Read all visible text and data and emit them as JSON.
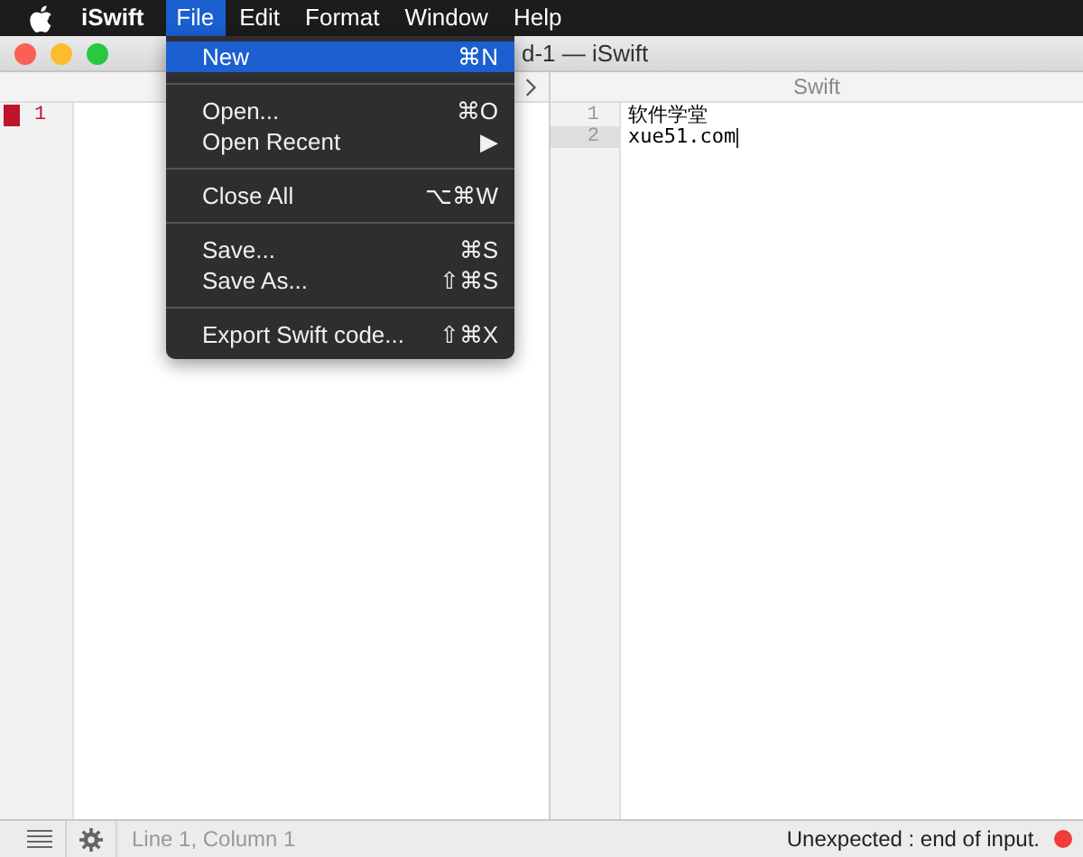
{
  "menu_bar": {
    "items": [
      {
        "label": "iSwift",
        "selected": false,
        "kind": "app"
      },
      {
        "label": "File",
        "selected": true,
        "kind": "menu"
      },
      {
        "label": "Edit",
        "selected": false,
        "kind": "menu"
      },
      {
        "label": "Format",
        "selected": false,
        "kind": "menu"
      },
      {
        "label": "Window",
        "selected": false,
        "kind": "menu"
      },
      {
        "label": "Help",
        "selected": false,
        "kind": "menu"
      }
    ]
  },
  "file_menu": {
    "groups": [
      [
        {
          "label": "New",
          "shortcut": "⌘N",
          "selected": true
        }
      ],
      [
        {
          "label": "Open...",
          "shortcut": "⌘O",
          "selected": false
        },
        {
          "label": "Open Recent",
          "shortcut": "▶",
          "selected": false
        }
      ],
      [
        {
          "label": "Close All",
          "shortcut": "⌥⌘W",
          "selected": false
        }
      ],
      [
        {
          "label": "Save...",
          "shortcut": "⌘S",
          "selected": false
        },
        {
          "label": "Save As...",
          "shortcut": "⇧⌘S",
          "selected": false
        }
      ],
      [
        {
          "label": "Export Swift code...",
          "shortcut": "⇧⌘X",
          "selected": false
        }
      ]
    ]
  },
  "window": {
    "title": "d-1 — iSwift"
  },
  "left_pane": {
    "lines": [
      {
        "number": "1",
        "error": true
      }
    ]
  },
  "right_pane": {
    "header": "Swift",
    "lines": [
      {
        "number": "1",
        "text": "软件学堂",
        "current": false
      },
      {
        "number": "2",
        "text": "xue51.com",
        "current": true
      }
    ]
  },
  "status_bar": {
    "position": "Line 1, Column 1",
    "message": "Unexpected :  end of input.",
    "error": true
  }
}
